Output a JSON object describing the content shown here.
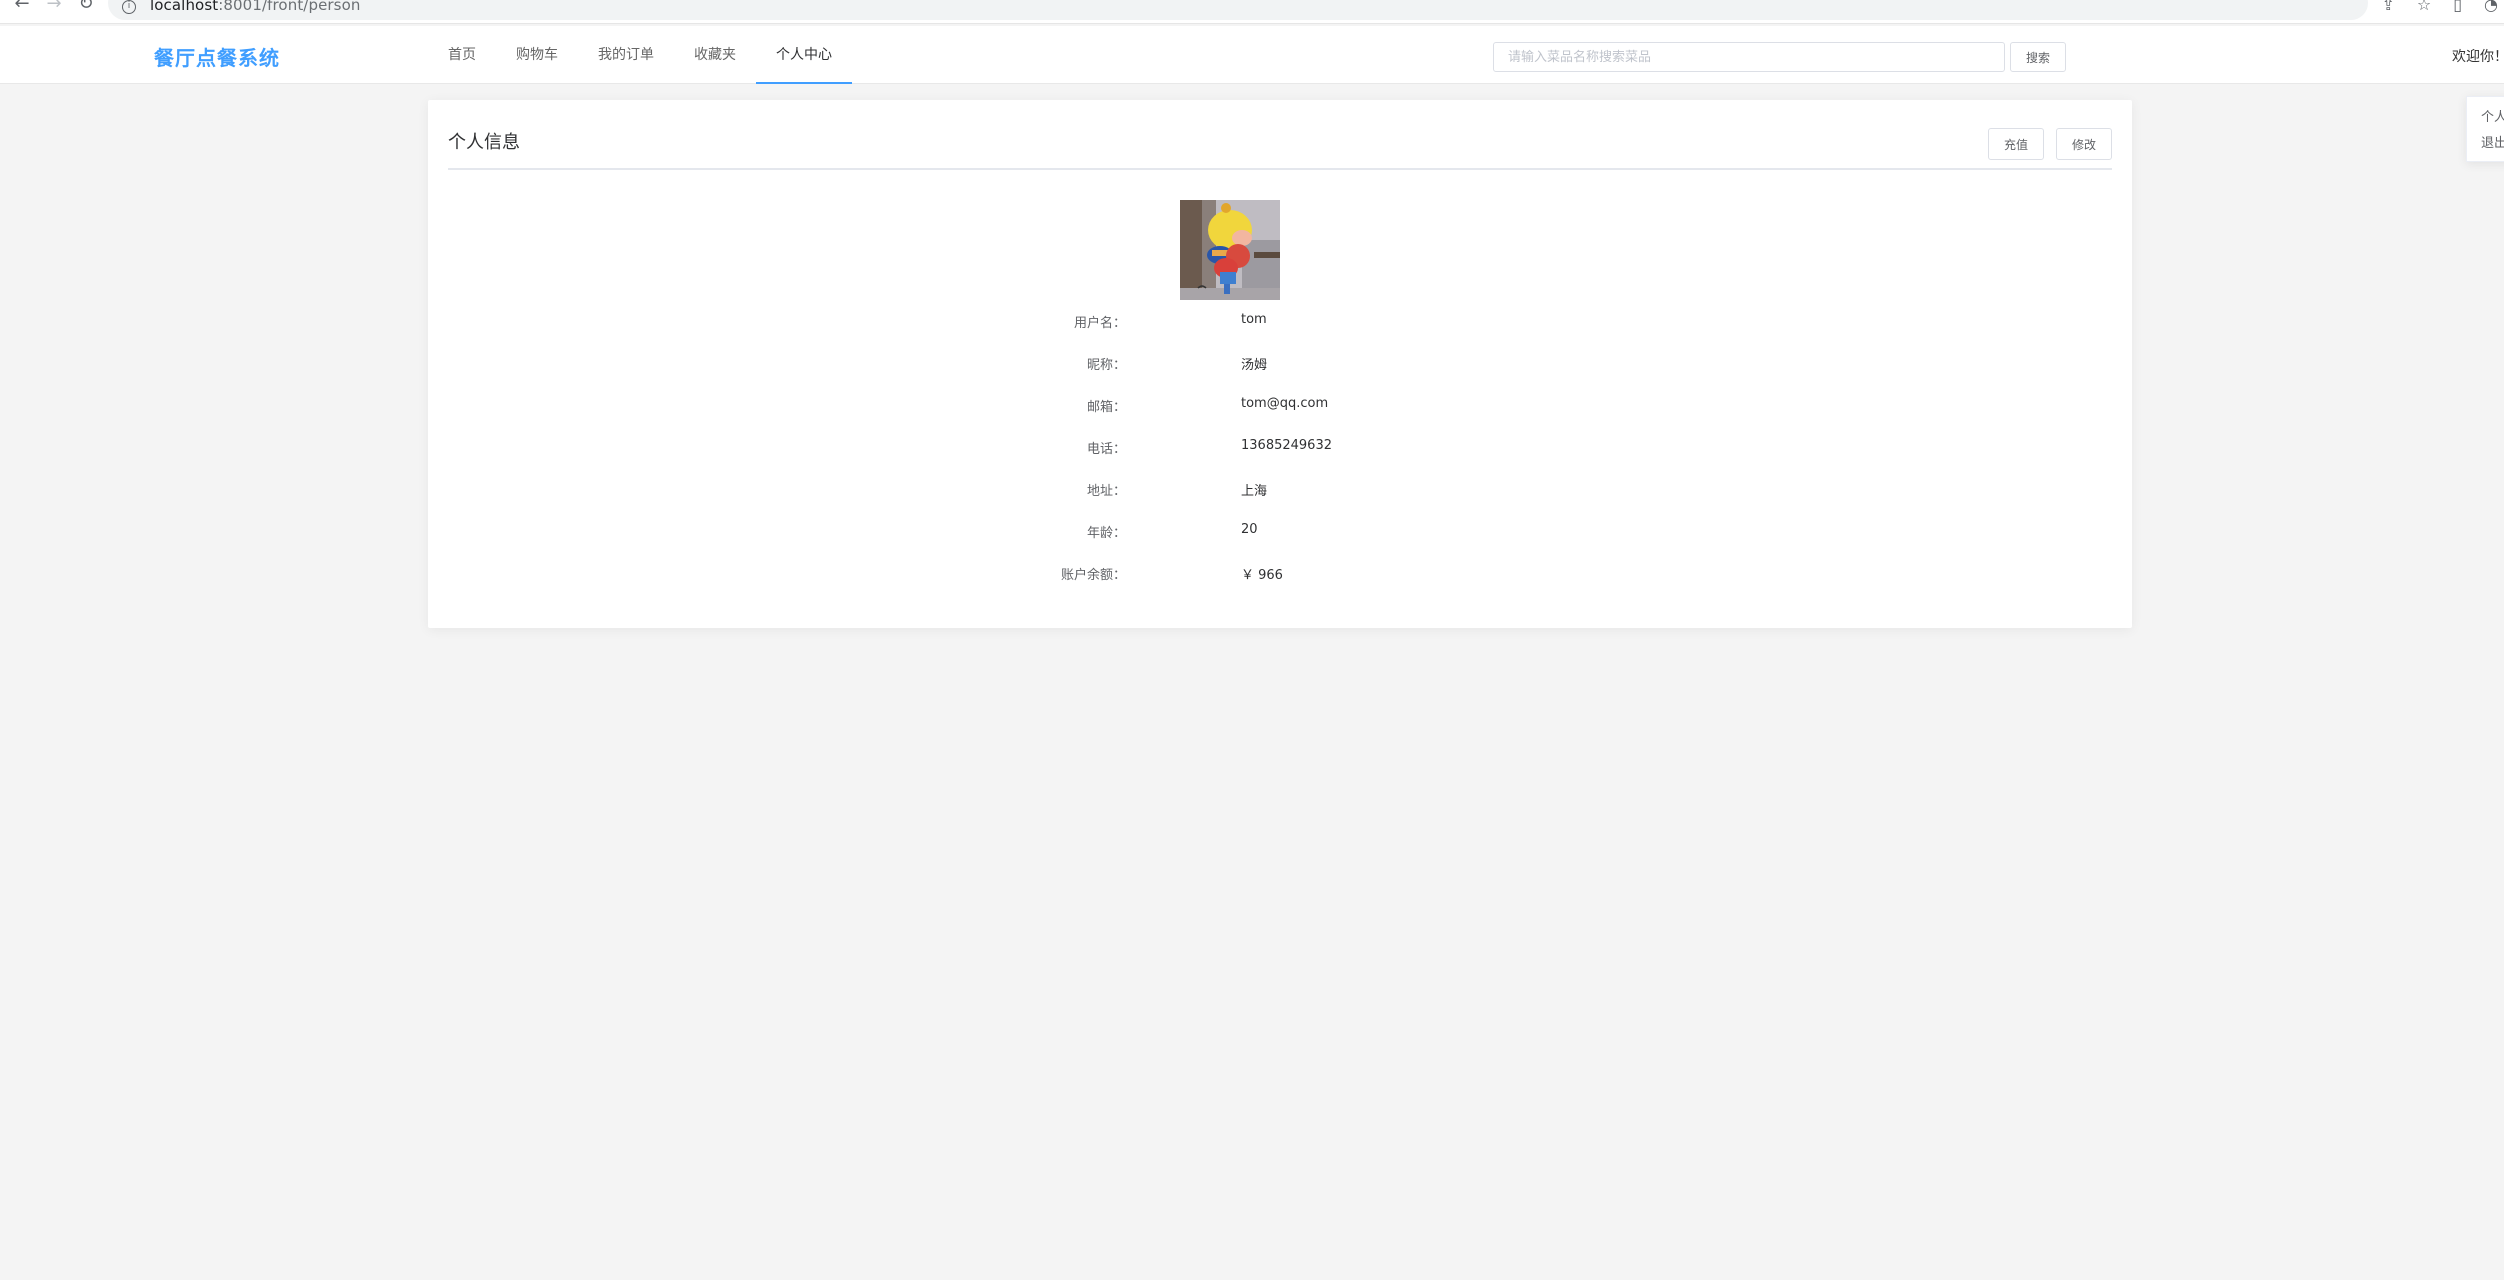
{
  "browser": {
    "url_host": "localhost",
    "url_rest": ":8001/front/person"
  },
  "header": {
    "brand": "餐厅点餐系统",
    "menu": [
      {
        "label": "首页",
        "active": false
      },
      {
        "label": "购物车",
        "active": false
      },
      {
        "label": "我的订单",
        "active": false
      },
      {
        "label": "收藏夹",
        "active": false
      },
      {
        "label": "个人中心",
        "active": true
      }
    ],
    "search_placeholder": "请输入菜品名称搜索菜品",
    "search_button": "搜索",
    "welcome": "欢迎你！"
  },
  "popover": {
    "items": [
      "个人",
      "退出"
    ]
  },
  "card": {
    "title": "个人信息",
    "recharge_button": "充值",
    "edit_button": "修改",
    "fields": [
      {
        "label": "用户名：",
        "value": "tom"
      },
      {
        "label": "昵称：",
        "value": "汤姆"
      },
      {
        "label": "邮箱：",
        "value": "tom@qq.com"
      },
      {
        "label": "电话：",
        "value": "13685249632"
      },
      {
        "label": "地址：",
        "value": "上海"
      },
      {
        "label": "年龄：",
        "value": "20"
      },
      {
        "label": "账户余额：",
        "value": "￥ 966"
      }
    ]
  },
  "colors": {
    "accent": "#409eff",
    "background": "#f4f4f4"
  }
}
